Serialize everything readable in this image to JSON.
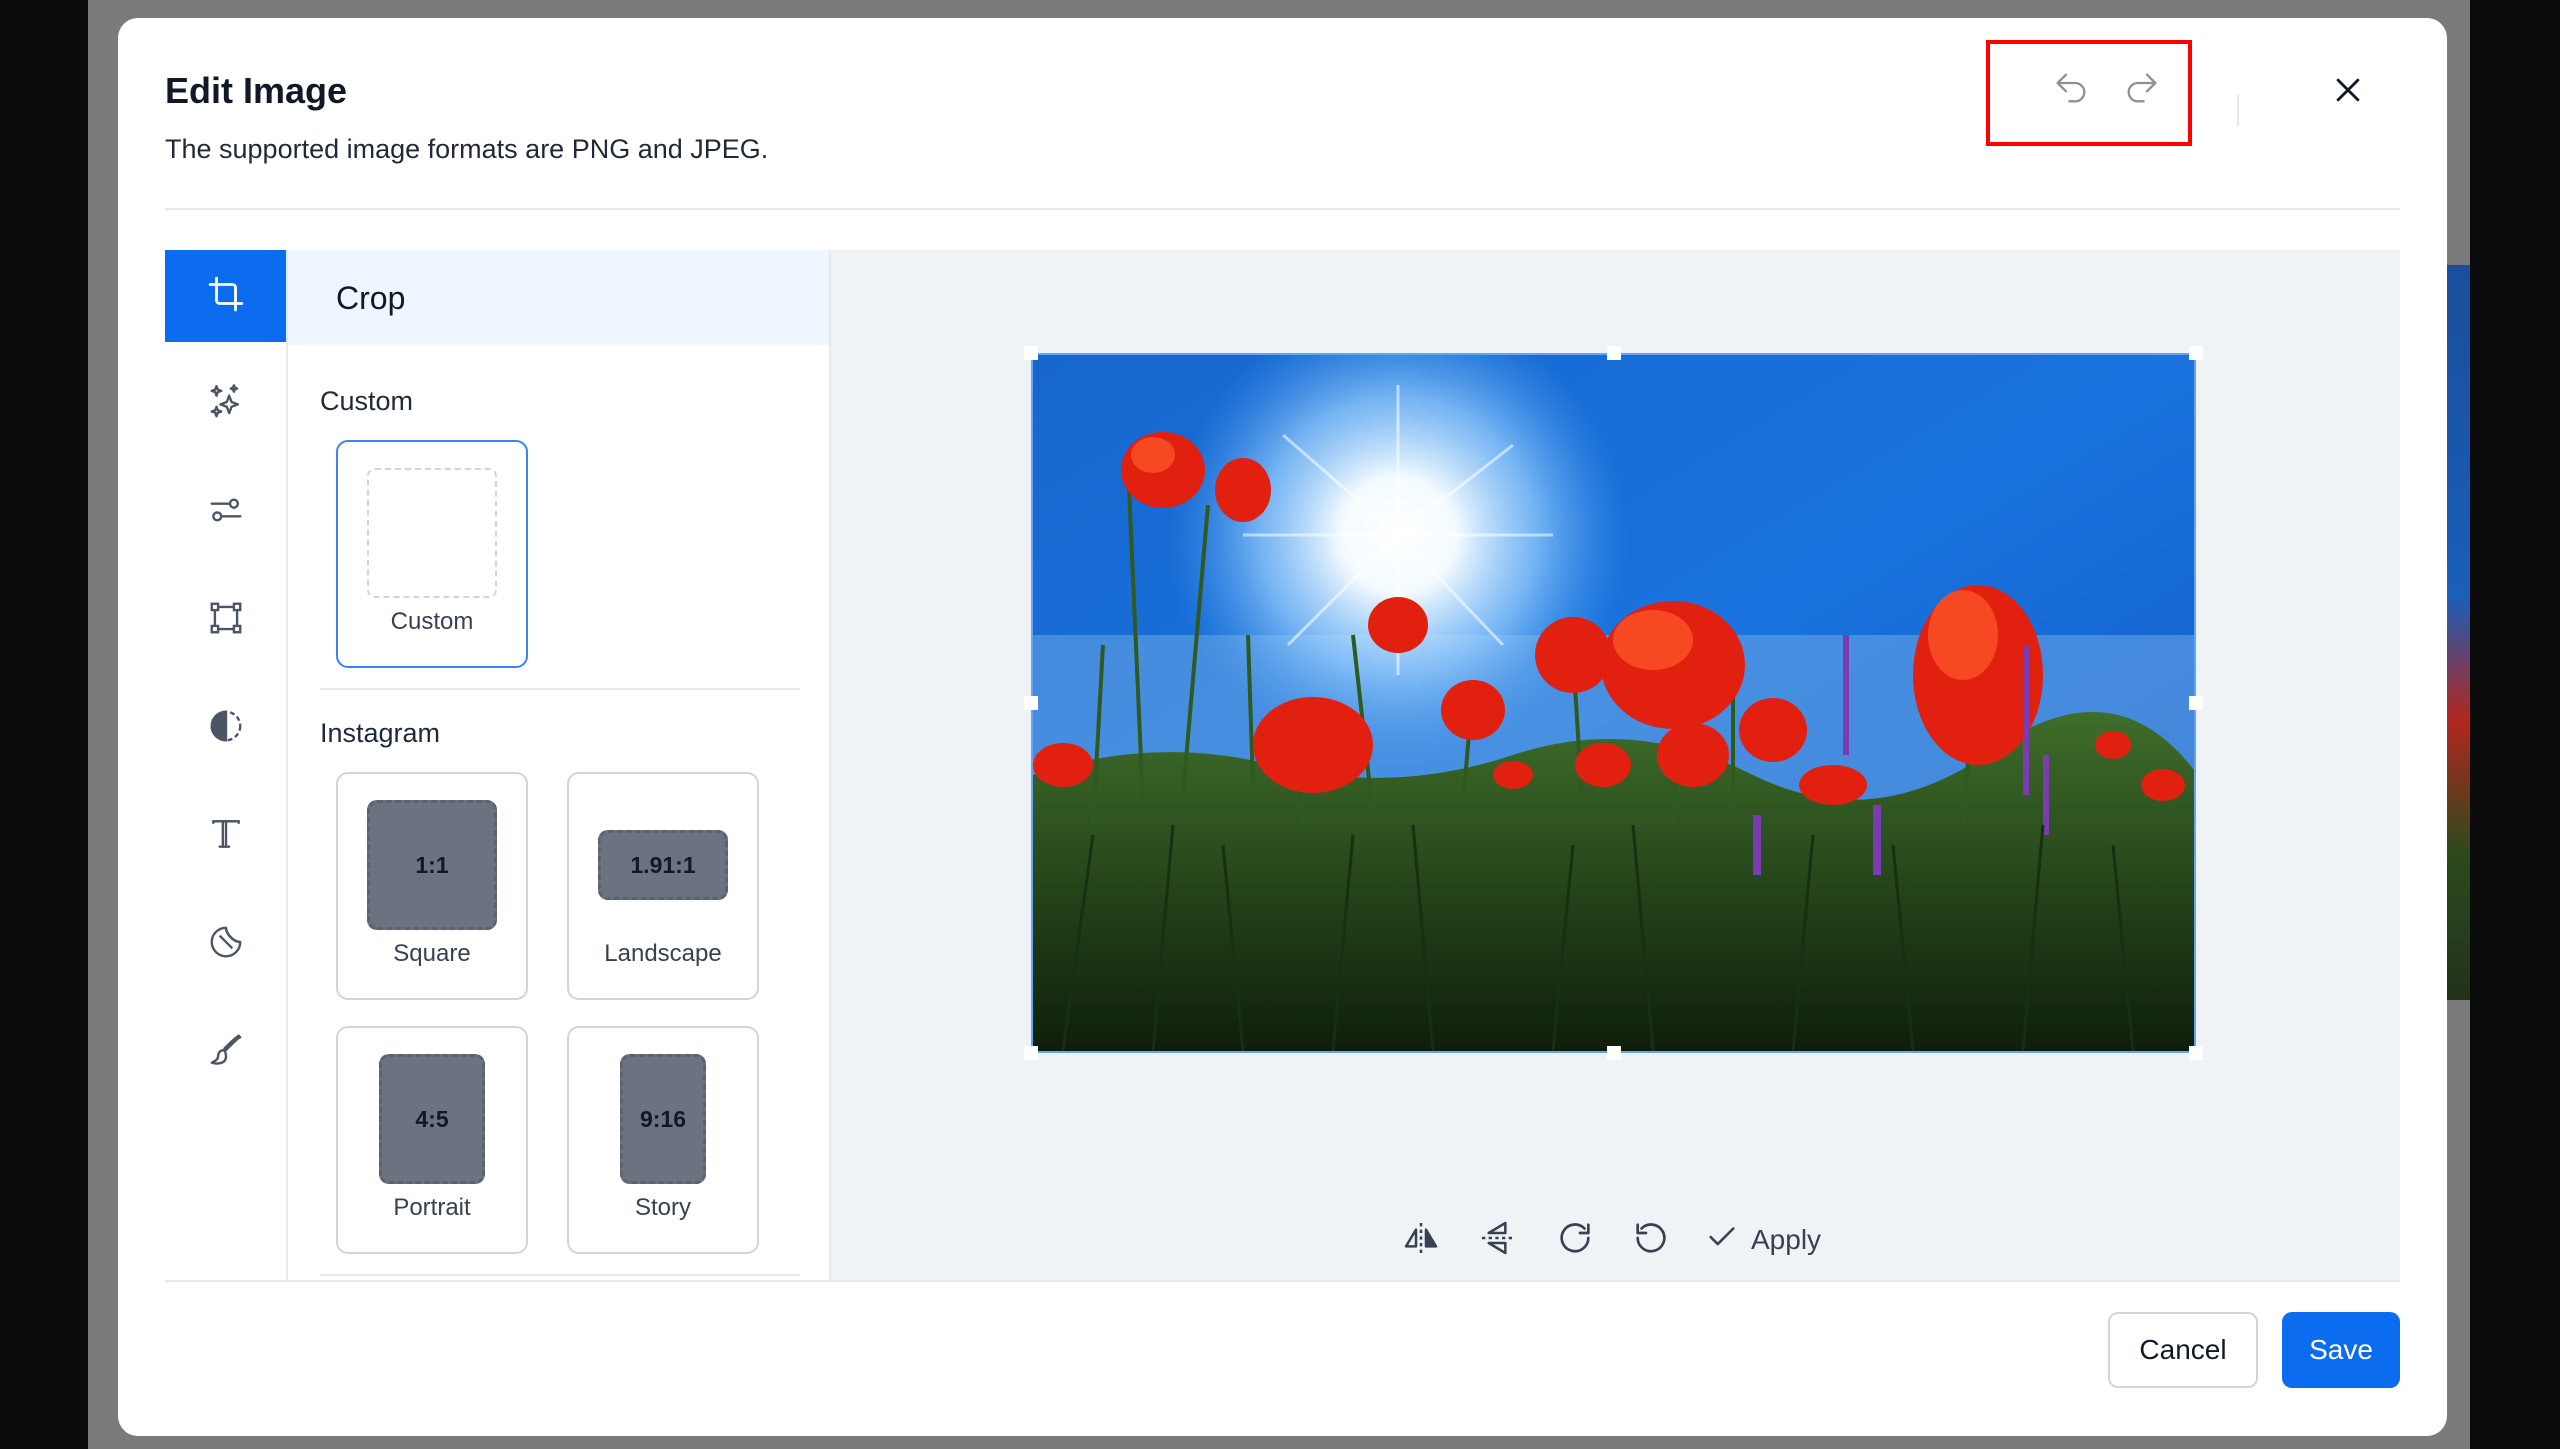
{
  "dialog": {
    "title": "Edit Image",
    "subtitle": "The supported image formats are PNG and JPEG."
  },
  "header_icons": {
    "undo": "undo-icon",
    "redo": "redo-icon",
    "close": "close-icon"
  },
  "toolbar": {
    "tools": [
      {
        "name": "crop",
        "icon": "crop-icon",
        "active": true
      },
      {
        "name": "filters",
        "icon": "sparkles-icon",
        "active": false
      },
      {
        "name": "adjust",
        "icon": "sliders-icon",
        "active": false
      },
      {
        "name": "resize",
        "icon": "transform-icon",
        "active": false
      },
      {
        "name": "contrast",
        "icon": "contrast-icon",
        "active": false
      },
      {
        "name": "text",
        "icon": "text-icon",
        "active": false
      },
      {
        "name": "shapes",
        "icon": "sticker-icon",
        "active": false
      },
      {
        "name": "draw",
        "icon": "brush-icon",
        "active": false
      }
    ],
    "accent_color": "#0b6cf0"
  },
  "crop_panel": {
    "title": "Crop",
    "custom_section": {
      "label": "Custom",
      "presets": [
        {
          "label": "Custom",
          "ratio": ""
        }
      ]
    },
    "instagram_section": {
      "label": "Instagram",
      "presets": [
        {
          "label": "Square",
          "ratio": "1:1"
        },
        {
          "label": "Landscape",
          "ratio": "1.91:1"
        },
        {
          "label": "Portrait",
          "ratio": "4:5"
        },
        {
          "label": "Story",
          "ratio": "9:16"
        }
      ]
    }
  },
  "canvas": {
    "tools": [
      "flip-horizontal-icon",
      "flip-vertical-icon",
      "rotate-clockwise-icon",
      "rotate-counterclockwise-icon"
    ],
    "apply_label": "Apply"
  },
  "footer": {
    "cancel_label": "Cancel",
    "save_label": "Save"
  }
}
